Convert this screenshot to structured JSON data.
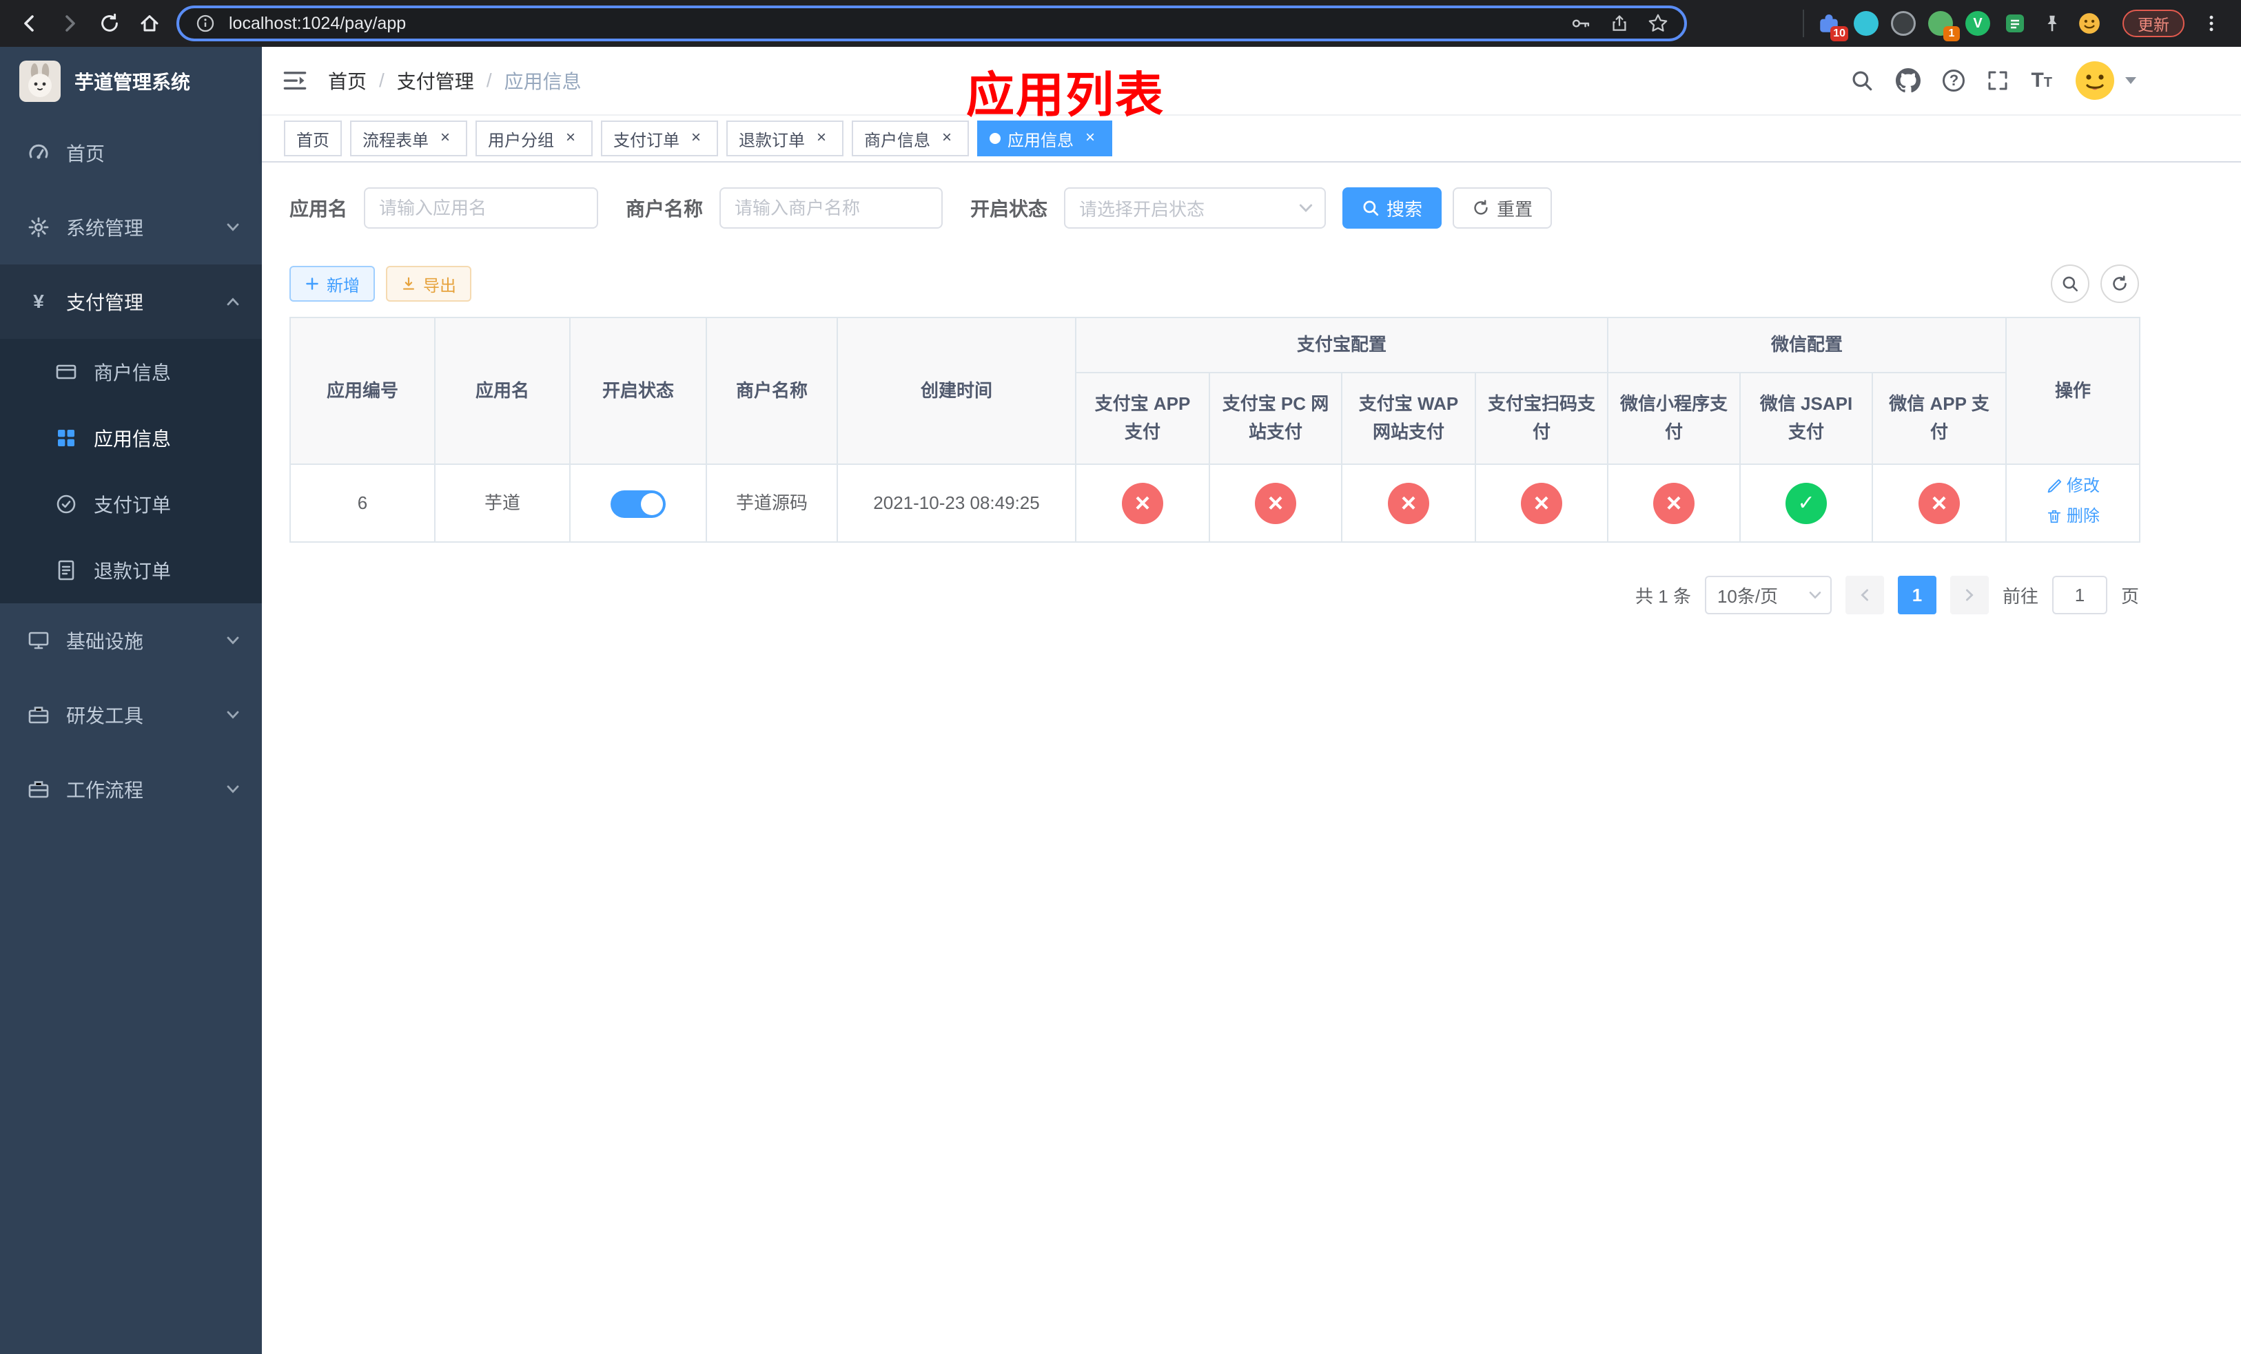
{
  "colors": {
    "accent": "#409eff",
    "danger": "#f56c6c",
    "success": "#13ce66",
    "warning": "#e6a23c",
    "sidebar_bg": "#304156",
    "submenu_bg": "#1f2d3d",
    "annotation_red": "#ff0000"
  },
  "browser": {
    "url": "localhost:1024/pay/app",
    "update_button": "更新",
    "extension_badge": "10",
    "avatar_badge": "1"
  },
  "sidebar": {
    "title": "芋道管理系统",
    "menu": [
      {
        "label": "首页"
      },
      {
        "label": "系统管理"
      },
      {
        "label": "支付管理"
      },
      {
        "label": "基础设施"
      },
      {
        "label": "研发工具"
      },
      {
        "label": "工作流程"
      }
    ],
    "submenu": [
      {
        "label": "商户信息"
      },
      {
        "label": "应用信息"
      },
      {
        "label": "支付订单"
      },
      {
        "label": "退款订单"
      }
    ]
  },
  "header": {
    "breadcrumb": [
      "首页",
      "支付管理",
      "应用信息"
    ],
    "breadcrumb_sep": "/",
    "annotation": "应用列表"
  },
  "tabs": [
    {
      "label": "首页"
    },
    {
      "label": "流程表单"
    },
    {
      "label": "用户分组"
    },
    {
      "label": "支付订单"
    },
    {
      "label": "退款订单"
    },
    {
      "label": "商户信息"
    },
    {
      "label": "应用信息"
    }
  ],
  "filters": {
    "app_name_label": "应用名",
    "app_name_placeholder": "请输入应用名",
    "merchant_label": "商户名称",
    "merchant_placeholder": "请输入商户名称",
    "status_label": "开启状态",
    "status_placeholder": "请选择开启状态",
    "search_button": "搜索",
    "reset_button": "重置"
  },
  "toolbar": {
    "add_button": "新增",
    "export_button": "导出"
  },
  "table": {
    "headers": {
      "app_id": "应用编号",
      "app_name": "应用名",
      "status": "开启状态",
      "merchant": "商户名称",
      "created": "创建时间",
      "alipay_group": "支付宝配置",
      "wechat_group": "微信配置",
      "alipay_app": "支付宝 APP 支付",
      "alipay_pc": "支付宝 PC 网站支付",
      "alipay_wap": "支付宝 WAP 网站支付",
      "alipay_scan": "支付宝扫码支付",
      "wechat_lite": "微信小程序支付",
      "wechat_jsapi": "微信 JSAPI 支付",
      "wechat_app": "微信 APP 支付",
      "actions": "操作"
    },
    "row": {
      "app_id": "6",
      "app_name": "芋道",
      "status_switch": "on",
      "merchant": "芋道源码",
      "created": "2021-10-23 08:49:25",
      "configs": [
        "disabled",
        "disabled",
        "disabled",
        "disabled",
        "disabled",
        "enabled",
        "disabled"
      ],
      "edit_label": "修改",
      "delete_label": "删除"
    }
  },
  "pagination": {
    "total": "共 1 条",
    "page_size": "10条/页",
    "current_page": "1",
    "goto_label": "前往",
    "goto_value": "1",
    "page_unit": "页"
  }
}
